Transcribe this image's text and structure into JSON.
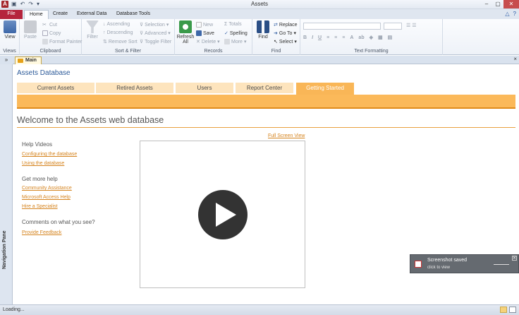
{
  "window": {
    "title": "Assets",
    "app_icon": "A",
    "quick_access": [
      "save-icon",
      "undo-icon",
      "redo-icon",
      "customize-icon"
    ]
  },
  "ribbon_tabs": [
    "File",
    "Home",
    "Create",
    "External Data",
    "Database Tools"
  ],
  "active_tab": "Home",
  "ribbon": {
    "views": {
      "view_label": "View",
      "group": "Views"
    },
    "clipboard": {
      "paste": "Paste",
      "cut": "Cut",
      "copy": "Copy",
      "format_painter": "Format Painter",
      "group": "Clipboard"
    },
    "sort_filter": {
      "filter": "Filter",
      "ascending": "Ascending",
      "descending": "Descending",
      "remove_sort": "Remove Sort",
      "selection": "Selection",
      "advanced": "Advanced",
      "toggle_filter": "Toggle Filter",
      "group": "Sort & Filter"
    },
    "records": {
      "refresh": "Refresh",
      "refresh_sub": "All",
      "new": "New",
      "save": "Save",
      "delete": "Delete",
      "totals": "Totals",
      "spelling": "Spelling",
      "more": "More",
      "group": "Records"
    },
    "find": {
      "find": "Find",
      "replace": "Replace",
      "goto": "Go To",
      "select": "Select",
      "group": "Find"
    },
    "text_formatting": {
      "group": "Text Formatting"
    }
  },
  "document_tab": {
    "label": "Main",
    "close": "×"
  },
  "nav_pane": {
    "label": "Navigation Pane",
    "toggle": "»"
  },
  "form": {
    "db_title": "Assets Database",
    "tabs": [
      "Current Assets",
      "Retired Assets",
      "Users",
      "Report Center",
      "Getting Started"
    ],
    "active_tab": "Getting Started",
    "welcome": "Welcome to the Assets web database",
    "full_screen": "Full Screen View",
    "sections": [
      {
        "heading": "Help Videos",
        "links": [
          "Configuring the database",
          "Using the database"
        ]
      },
      {
        "heading": "Get more help",
        "links": [
          "Community Assistance",
          "Microsoft Access Help",
          "Hire a Specialist"
        ]
      },
      {
        "heading": "Comments on what you see?",
        "links": [
          "Provide Feedback"
        ]
      }
    ]
  },
  "toast": {
    "title": "Screenshot saved",
    "subtitle": "click to view"
  },
  "status": {
    "text": "Loading..."
  },
  "colors": {
    "accent_orange": "#f9b657",
    "link": "#d5841f",
    "file_tab": "#b5243c",
    "title_blue": "#2c5a99"
  }
}
